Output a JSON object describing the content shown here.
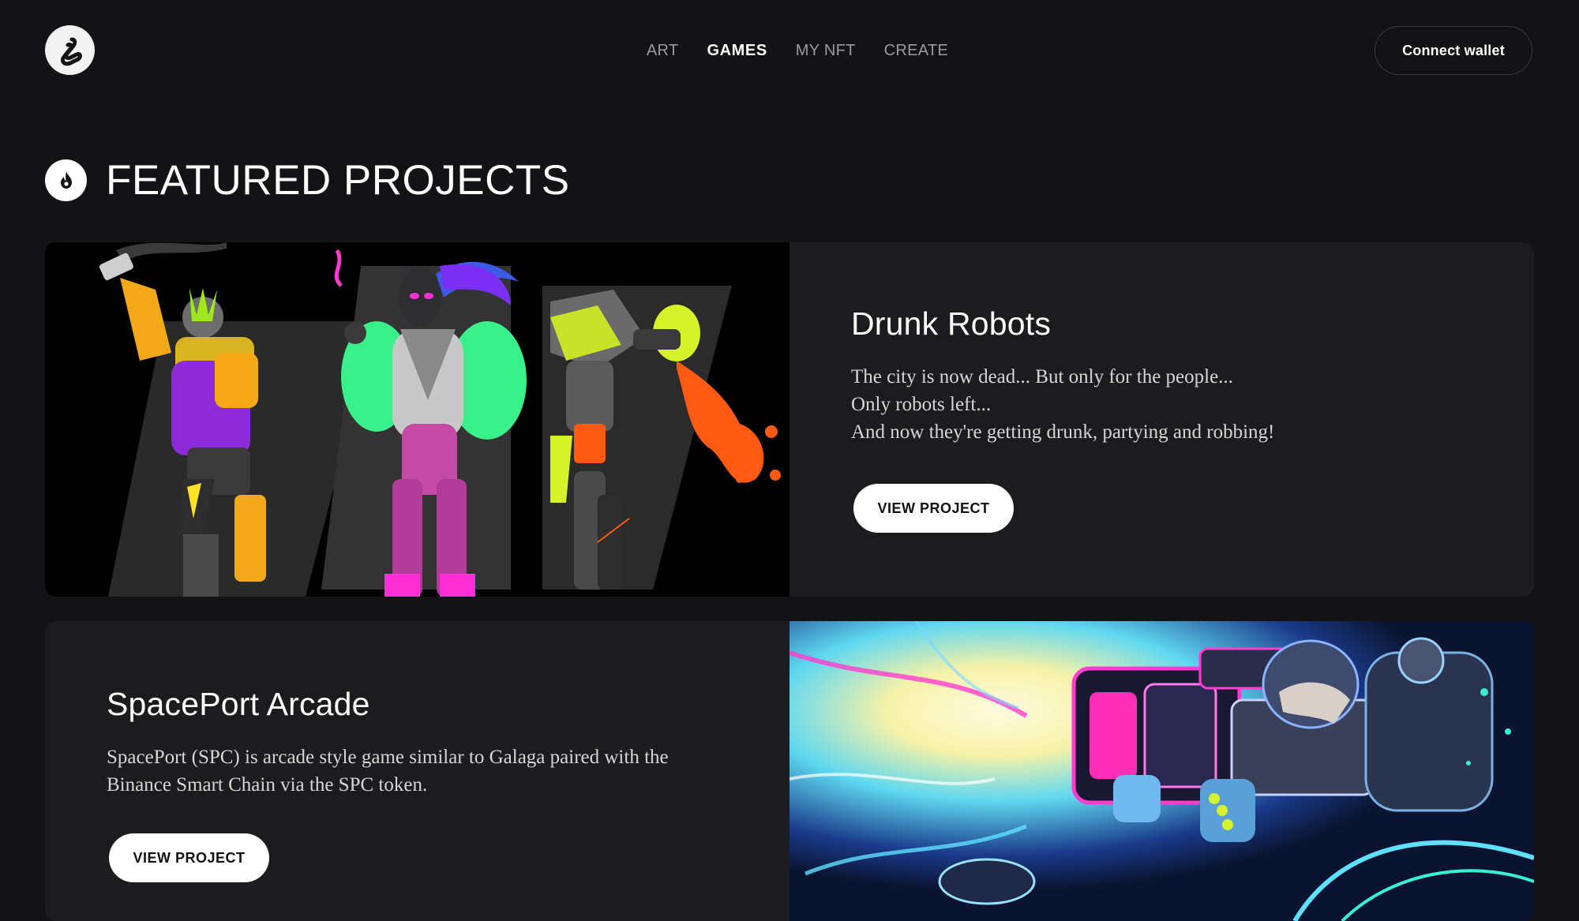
{
  "header": {
    "logo_icon": "brand-swirl-icon",
    "nav": [
      {
        "label": "ART",
        "active": false
      },
      {
        "label": "GAMES",
        "active": true
      },
      {
        "label": "MY NFT",
        "active": false
      },
      {
        "label": "CREATE",
        "active": false
      }
    ],
    "connect_label": "Connect wallet"
  },
  "section": {
    "icon": "fire-icon",
    "title": "FEATURED PROJECTS"
  },
  "projects": [
    {
      "title": "Drunk Robots",
      "description_lines": [
        "The city is now dead... But only for the people...",
        "Only robots left...",
        "And now they're getting drunk, partying and robbing!"
      ],
      "button_label": "VIEW PROJECT"
    },
    {
      "title": "SpacePort Arcade",
      "description_lines": [
        "SpacePort (SPC) is arcade style game similar to Galaga paired with the",
        "Binance Smart Chain via the SPC token."
      ],
      "button_label": "VIEW PROJECT"
    }
  ],
  "colors": {
    "background": "#131315",
    "card": "#1c1c1e",
    "nav_inactive": "#9a9a9f",
    "accent_purple": "#8e2bd8",
    "accent_green": "#3af08a",
    "accent_orange": "#ff5a14"
  }
}
